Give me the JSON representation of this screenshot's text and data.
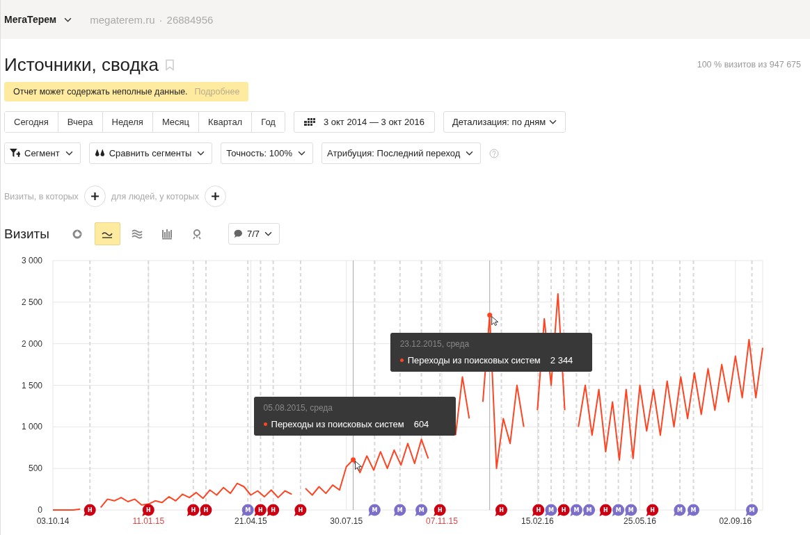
{
  "header": {
    "account": "МегаТерем",
    "site": "megaterem.ru",
    "separator": "·",
    "counter_id": "26884956"
  },
  "title": "Источники, сводка",
  "visits_summary": "100 % визитов из 947 675",
  "notice": {
    "text": "Отчет может содержать неполные данные.",
    "link": "Подробнее"
  },
  "periods": [
    {
      "label": "Сегодня",
      "selected": false
    },
    {
      "label": "Вчера",
      "selected": false
    },
    {
      "label": "Неделя",
      "selected": false
    },
    {
      "label": "Месяц",
      "selected": false
    },
    {
      "label": "Квартал",
      "selected": false
    },
    {
      "label": "Год",
      "selected": false
    }
  ],
  "date_range": "3 окт 2014 — 3 окт 2016",
  "detail": "Детализация: по дням",
  "filters": [
    {
      "label": "Сегмент",
      "kind": "segment"
    },
    {
      "label": "Сравнить сегменты",
      "kind": "compare"
    },
    {
      "label": "Точность: 100%",
      "kind": "plain"
    },
    {
      "label": "Атрибуция: Последний переход",
      "kind": "plain"
    }
  ],
  "conditions": [
    "Визиты, в которых",
    "для людей, у которых"
  ],
  "chart_section": {
    "title": "Визиты",
    "view_buttons": [
      {
        "kind": "pie",
        "selected": false
      },
      {
        "kind": "line",
        "selected": true
      },
      {
        "kind": "area",
        "selected": false
      },
      {
        "kind": "bars",
        "selected": false
      },
      {
        "kind": "map",
        "selected": false
      }
    ],
    "notes_filter": "7/7",
    "chart_data": {
      "type": "line",
      "ylim": [
        0,
        3000
      ],
      "grid": true,
      "yticks": [
        0,
        500,
        {
          "value": 1000,
          "label": "1 000"
        },
        {
          "value": 1500,
          "label": "1 500"
        },
        {
          "value": 2000,
          "label": "2 000"
        },
        {
          "value": 2500,
          "label": "2 500"
        },
        {
          "value": 3000,
          "label": "3 000"
        }
      ],
      "categories": [
        "03.10.14",
        null,
        null,
        null,
        null,
        null,
        null,
        null,
        null,
        null,
        null,
        null,
        null,
        null,
        "11.01.15",
        null,
        null,
        null,
        null,
        null,
        null,
        null,
        null,
        null,
        null,
        null,
        null,
        null,
        null,
        "21.04.15",
        null,
        null,
        null,
        null,
        null,
        null,
        null,
        null,
        null,
        null,
        null,
        null,
        null,
        "30.07.15",
        null,
        null,
        null,
        null,
        null,
        null,
        null,
        null,
        null,
        null,
        null,
        null,
        null,
        "07.11.15",
        null,
        null,
        null,
        null,
        null,
        null,
        null,
        null,
        null,
        null,
        null,
        null,
        null,
        "15.02.16",
        null,
        null,
        null,
        null,
        null,
        null,
        null,
        null,
        null,
        null,
        null,
        null,
        null,
        null,
        "25.05.16",
        null,
        null,
        null,
        null,
        null,
        null,
        null,
        null,
        null,
        null,
        null,
        null,
        null,
        "02.09.16",
        null,
        null,
        null,
        null
      ],
      "series": [
        {
          "name": "Переходы из поисковых систем",
          "color": "#ff4422",
          "values": [
            0,
            0,
            0,
            0,
            10,
            null,
            null,
            30,
            130,
            110,
            150,
            100,
            130,
            60,
            70,
            110,
            90,
            160,
            110,
            190,
            150,
            210,
            140,
            240,
            180,
            270,
            200,
            320,
            280,
            180,
            230,
            160,
            240,
            150,
            230,
            190,
            null,
            260,
            180,
            280,
            200,
            300,
            240,
            520,
            604,
            450,
            650,
            480,
            700,
            500,
            720,
            540,
            800,
            560,
            850,
            620,
            null,
            null,
            null,
            900,
            1600,
            1100,
            null,
            1300,
            2344,
            500,
            1100,
            800,
            1500,
            1000,
            null,
            1200,
            2300,
            1500,
            2600,
            1200,
            null,
            1000,
            1500,
            900,
            1450,
            700,
            1300,
            600,
            1450,
            620,
            1500,
            950,
            1450,
            900,
            1550,
            1000,
            1600,
            1100,
            1650,
            1150,
            1700,
            1200,
            1750,
            1300,
            1850,
            1350,
            2050,
            1350,
            1950
          ]
        }
      ]
    },
    "x_label_highlight": [
      false,
      true,
      false,
      false,
      true,
      false,
      false,
      false
    ],
    "notes": [
      {
        "label": "Н",
        "color": "#cc0011"
      },
      {
        "label": "Н",
        "color": "#cc0011"
      },
      {
        "label": "Н",
        "color": "#cc0011"
      },
      {
        "label": "Н",
        "color": "#cc0011"
      },
      {
        "label": "М",
        "color": "#7b6fc9"
      },
      {
        "label": "Н",
        "color": "#cc0011"
      },
      {
        "label": "Н",
        "color": "#cc0011"
      },
      {
        "label": "Н",
        "color": "#cc0011"
      },
      {
        "label": "М",
        "color": "#7b6fc9"
      },
      {
        "label": "М",
        "color": "#7b6fc9"
      },
      {
        "label": "М",
        "color": "#7b6fc9"
      },
      {
        "label": "Н",
        "color": "#cc0011"
      },
      {
        "label": "Н",
        "color": "#cc0011"
      },
      {
        "label": "Н",
        "color": "#cc0011"
      },
      {
        "label": "М",
        "color": "#7b6fc9"
      },
      {
        "label": "Н",
        "color": "#cc0011"
      },
      {
        "label": "М",
        "color": "#7b6fc9"
      },
      {
        "label": "М",
        "color": "#7b6fc9"
      },
      {
        "label": "Н",
        "color": "#cc0011"
      },
      {
        "label": "М",
        "color": "#7b6fc9"
      },
      {
        "label": "М",
        "color": "#7b6fc9"
      },
      {
        "label": "Н",
        "color": "#cc0011"
      },
      {
        "label": "М",
        "color": "#7b6fc9"
      },
      {
        "label": "М",
        "color": "#7b6fc9"
      },
      {
        "label": "М",
        "color": "#7b6fc9"
      }
    ],
    "tooltips": [
      {
        "date": "23.12.2015, среда",
        "value": "2 344"
      },
      {
        "date": "05.08.2015, среда",
        "value": "604"
      }
    ]
  }
}
